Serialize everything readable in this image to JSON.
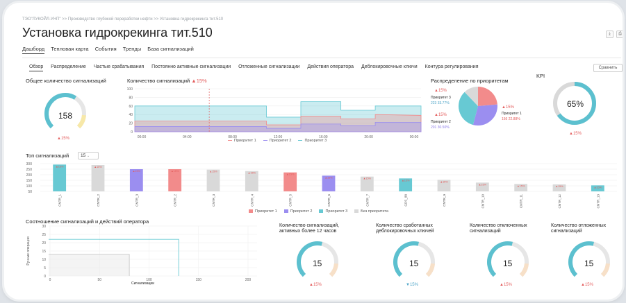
{
  "breadcrumb": "ТЭО\"ЛУКОЙЛ-УНП\" >> Производство глубокой переработки нефти >> Установка гидрокрекинга тит.510",
  "page_title": "Установка гидрокрекинга тит.510",
  "top_buttons": {
    "download": "⤓",
    "print": "⎙"
  },
  "main_tabs": [
    "Дашборд",
    "Тепловая карта",
    "События",
    "Тренды",
    "База сигнализаций"
  ],
  "sub_tabs": [
    "Обзор",
    "Распределение",
    "Частые срабатывания",
    "Постоянно активные сигнализации",
    "Отложенные сигнализации",
    "Действия оператора",
    "Деблокировочные ключи",
    "Контура регулирования"
  ],
  "compare_button": "Сравнить",
  "colors": {
    "p1": "#f28b8b",
    "p2": "#9b8ef0",
    "p3": "#67c9d3",
    "none": "#d9d9d9",
    "up": "#e35d5d",
    "down": "#4aa3c7"
  },
  "total": {
    "title": "Общее количество сигнализаций",
    "value": "158",
    "trend": "▲15%"
  },
  "timeline": {
    "title": "Количество сигнализаций",
    "trend": "▲15%",
    "chart_data": {
      "type": "area",
      "y_ticks": [
        "100",
        "80",
        "60",
        "40",
        "20",
        "0"
      ],
      "x_ticks": [
        "00:00",
        "04:00",
        "08:00",
        "12:00",
        "16:00",
        "20:00",
        "00:00"
      ],
      "series": [
        {
          "name": "Приоритет 1"
        },
        {
          "name": "Приоритет 2"
        },
        {
          "name": "Приоритет 3"
        }
      ]
    }
  },
  "priority": {
    "title": "Распределение по приоритетам",
    "chart_data": {
      "type": "pie",
      "slices": [
        {
          "name": "Приоритет 1",
          "value": 156,
          "pct": "22.88%",
          "trend": "▲15%"
        },
        {
          "name": "Приоритет 2",
          "value": 201,
          "pct": "30.50%",
          "trend": "▲15%"
        },
        {
          "name": "Приоритет 3",
          "value": 223,
          "pct": "33.77%",
          "trend": "▲15%"
        },
        {
          "name": "Без приоритета",
          "value": 80
        }
      ]
    },
    "labels": {
      "p3_name": "Приоритет 3",
      "p3_val": "223",
      "p3_pct": "33.77%",
      "p1_name": "Приоритет 1",
      "p1_val": "156",
      "p1_pct": "22.88%",
      "p2_name": "Приоритет 2",
      "p2_val": "201",
      "p2_pct": "30.50%",
      "trend": "▲15%"
    }
  },
  "kpi": {
    "title": "KPI",
    "value": "65%",
    "fraction": 0.65,
    "trend": "▲15%"
  },
  "top": {
    "title": "Топ сигнализаций",
    "select": "15",
    "chart_data": {
      "type": "bar",
      "y_ticks": [
        "300",
        "250",
        "200",
        "150",
        "100",
        "50"
      ],
      "categories": [
        "CNTR_1",
        "CNTR_2",
        "CNTR_3",
        "CNTR_2",
        "CNTR_3",
        "CNTR_4",
        "CNTR_5",
        "CNTR_6",
        "CNTR_7",
        "GDS_88",
        "CNTR_9",
        "CNTR_10",
        "CNTR_11",
        "CNTR_12",
        "CNTR_13"
      ],
      "values": [
        290,
        285,
        240,
        240,
        235,
        220,
        205,
        170,
        160,
        140,
        125,
        95,
        80,
        75,
        65
      ],
      "priority": [
        "p3",
        "none",
        "p2",
        "p1",
        "none",
        "none",
        "p1",
        "p2",
        "none",
        "p3",
        "none",
        "none",
        "none",
        "none",
        "p3"
      ],
      "labels": [
        "▲15%",
        "▲15%",
        "▲15%",
        "▲15%",
        "▲15%",
        "▲15%",
        "▲15%",
        "▲15%",
        "▲15%",
        "▲15%",
        "▲15%",
        "▲15%",
        "▲15%",
        "▲15%",
        "▲15%"
      ]
    },
    "legend": [
      "Приоритет 1",
      "Приоритет 2",
      "Приоритет 3",
      "Без приоритета"
    ]
  },
  "ratio": {
    "title": "Соотношение сигнализаций и действий оператора",
    "ylabel": "Ручные операции",
    "xlabel": "Сигнализации",
    "y_ticks": [
      "30",
      "25",
      "20",
      "15",
      "10",
      "5",
      "0"
    ],
    "x_ticks": [
      "0",
      "50",
      "100",
      "150",
      "200"
    ]
  },
  "gauges": [
    {
      "title": "Количество сигнализаций, активных более 12 часов",
      "value": "15",
      "trend": "▲15%",
      "dir": "up"
    },
    {
      "title": "Количество сработанных деблокировочных ключей",
      "value": "15",
      "trend": "▼15%",
      "dir": "down"
    },
    {
      "title": "Количество отключенных сигнализаций",
      "value": "15",
      "trend": "▲15%",
      "dir": "up"
    },
    {
      "title": "Количество отложенных сигнализаций",
      "value": "15",
      "trend": "▲15%",
      "dir": "up"
    }
  ]
}
